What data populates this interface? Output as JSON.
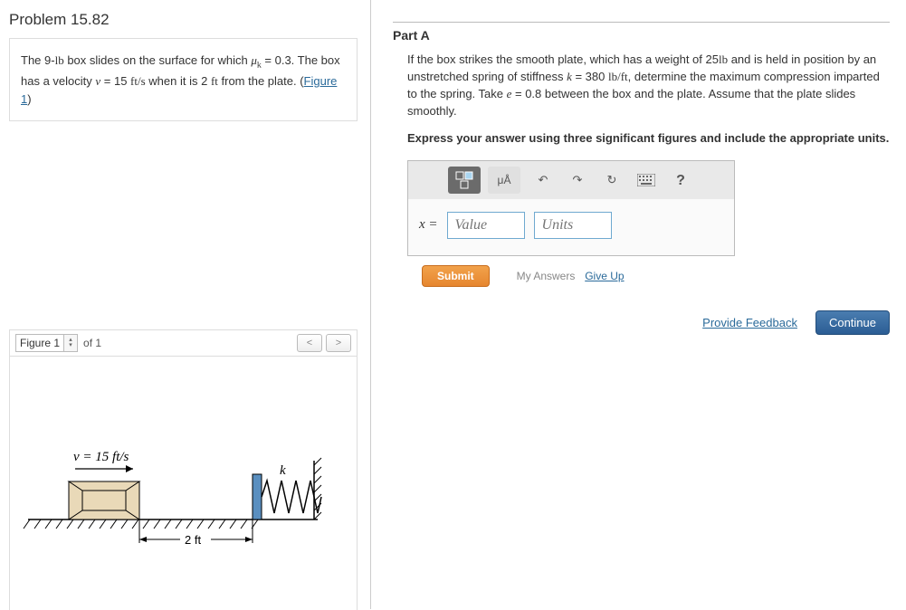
{
  "problem": {
    "title": "Problem 15.82",
    "statement_pre": "The 9-",
    "unit_lb": "lb",
    "statement_mid1": " box slides on the surface for which ",
    "mu": "μ",
    "mu_sub": "k",
    "eq1": " = 0.3. The box has a velocity ",
    "v": "v",
    "eq2": " = 15 ",
    "ft": "ft",
    "slash_s": "/s",
    "eq3": " when it is 2 ",
    "ft2": "ft",
    "eq4": " from the plate. (",
    "fig_link": "Figure 1",
    "close": ")"
  },
  "figure": {
    "label": "Figure 1",
    "of": "of 1",
    "v_label": "v = 15 ft/s",
    "k_label": "k",
    "dist_label": "2 ft"
  },
  "partA": {
    "heading": "Part A",
    "body_1": "If the box strikes the smooth plate, which has a weight of 25",
    "lb": "lb",
    "body_2": " and is held in position by an unstretched spring of stiffness ",
    "k": "k",
    "body_3": " = 380 ",
    "lbft": "lb/ft",
    "body_4": ", determine the maximum compression imparted to the spring. Take ",
    "e": "e",
    "body_5": " = 0.8 between the box and the plate. Assume that the plate slides smoothly.",
    "instruction": "Express your answer using three significant figures and include the appropriate units."
  },
  "toolbar": {
    "mua": "μÅ",
    "help": "?"
  },
  "answer": {
    "var": "x =",
    "value_placeholder": "Value",
    "units_placeholder": "Units"
  },
  "actions": {
    "submit": "Submit",
    "my_answers": "My Answers",
    "give_up": "Give Up",
    "feedback": "Provide Feedback",
    "continue": "Continue"
  }
}
